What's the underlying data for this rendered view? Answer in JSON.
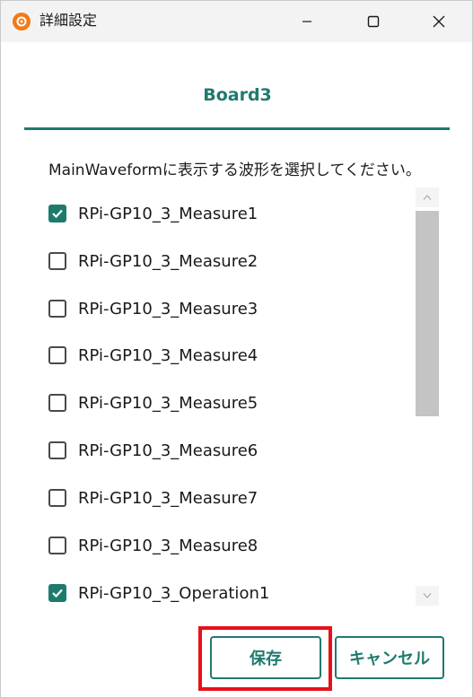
{
  "window": {
    "title": "詳細設定",
    "icons": {
      "app": "app-logo-icon",
      "minimize": "minimize-icon",
      "maximize": "maximize-icon",
      "close": "close-icon"
    }
  },
  "dialog": {
    "board_title": "Board3",
    "instruction": "MainWaveformに表示する波形を選択してください。",
    "items": [
      {
        "label": "RPi-GP10_3_Measure1",
        "checked": true
      },
      {
        "label": "RPi-GP10_3_Measure2",
        "checked": false
      },
      {
        "label": "RPi-GP10_3_Measure3",
        "checked": false
      },
      {
        "label": "RPi-GP10_3_Measure4",
        "checked": false
      },
      {
        "label": "RPi-GP10_3_Measure5",
        "checked": false
      },
      {
        "label": "RPi-GP10_3_Measure6",
        "checked": false
      },
      {
        "label": "RPi-GP10_3_Measure7",
        "checked": false
      },
      {
        "label": "RPi-GP10_3_Measure8",
        "checked": false
      },
      {
        "label": "RPi-GP10_3_Operation1",
        "checked": true
      }
    ],
    "save_label": "保存",
    "cancel_label": "キャンセル"
  },
  "colors": {
    "accent": "#1f7a6e",
    "highlight": "#e8101a",
    "app_icon": "#f07b1a"
  }
}
